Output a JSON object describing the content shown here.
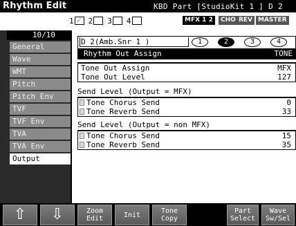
{
  "title": "Rhythm Edit",
  "header_right": "KBD Part  [StudioKit 1 ] D 2",
  "parts": [
    {
      "label": "1",
      "checked": true
    },
    {
      "label": "2",
      "checked": false
    },
    {
      "label": "3",
      "checked": false
    },
    {
      "label": "4",
      "checked": false
    }
  ],
  "chips": [
    "MFX 1 2",
    "CHO",
    "REV",
    "MASTER"
  ],
  "counter": "10/10",
  "tabs": [
    "General",
    "Wave",
    "WMT",
    "Pitch",
    "Pitch Env",
    "TVF",
    "TVF Env",
    "TVA",
    "TVA Env",
    "Output"
  ],
  "active_tab": "Output",
  "tone": {
    "name": "D 2(Amb.Snr 1   )",
    "circles": [
      "1",
      "2",
      "3",
      "4"
    ],
    "head_left": "Rhythm Out Assign",
    "head_right": "TONE"
  },
  "out_rows": [
    {
      "label": "Tone Out Assign",
      "value": "MFX"
    },
    {
      "label": "Tone Out Level",
      "value": "127"
    }
  ],
  "send_mfx": {
    "title": "Send Level (Output = MFX)",
    "rows": [
      {
        "label": "Tone Chorus Send",
        "value": "0"
      },
      {
        "label": "Tone Reverb Send",
        "value": "33"
      }
    ]
  },
  "send_non_mfx": {
    "title": "Send Level (Output = non MFX)",
    "rows": [
      {
        "label": "Tone Chorus Send",
        "value": "15"
      },
      {
        "label": "Tone Reverb Send",
        "value": "35"
      }
    ]
  },
  "buttons": {
    "up": "⇧",
    "down": "⇩",
    "zoom": "Zoom\nEdit",
    "init": "Init",
    "copy": "Tone\nCopy",
    "part_select": "Part\nSelect",
    "wave_sw": "Wave\nSw/Sel"
  }
}
